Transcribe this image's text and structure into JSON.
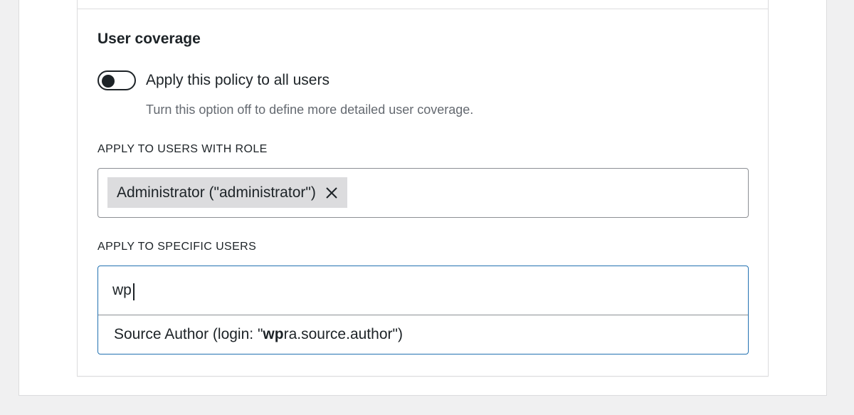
{
  "user_coverage": {
    "title": "User coverage",
    "toggle": {
      "label": "Apply this policy to all users",
      "state": "off",
      "help": "Turn this option off to define more detailed user coverage."
    },
    "roles": {
      "label": "APPLY TO USERS WITH ROLE",
      "tokens": [
        {
          "label": "Administrator (\"administrator\")",
          "remove_icon": "close-icon"
        }
      ]
    },
    "specific_users": {
      "label": "APPLY TO SPECIFIC USERS",
      "input_value": "wp",
      "suggestions": [
        {
          "prefix": "Source Author (login: \"",
          "match": "wp",
          "suffix": "ra.source.author\")"
        }
      ]
    }
  },
  "colors": {
    "focus_border": "#2271b1",
    "token_bg": "#dcdcde",
    "help_text": "#646970",
    "page_bg": "#f0f0f1"
  }
}
